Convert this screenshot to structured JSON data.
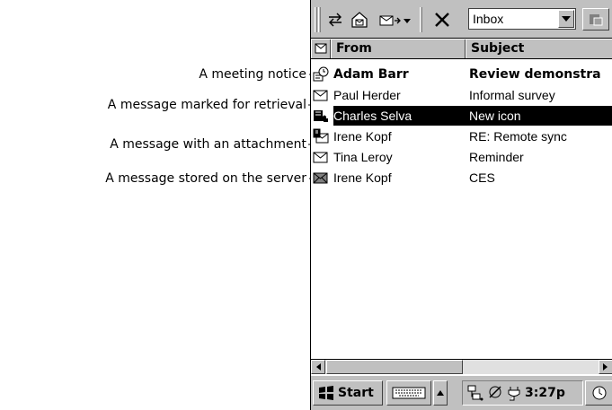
{
  "callouts": [
    {
      "text": "A meeting notice"
    },
    {
      "text": "A message marked for retrieval"
    },
    {
      "text": "A message with an attachment"
    },
    {
      "text": "A message stored on the server"
    }
  ],
  "toolbar": {
    "folder_selected": "Inbox",
    "icons": [
      "reply-arrows-icon",
      "send-receive-icon",
      "move-dropdown-icon",
      "delete-x-icon",
      "folder-dropdown-icon",
      "disabled-action-icon"
    ]
  },
  "list": {
    "columns": [
      "From",
      "Subject"
    ],
    "header_icon": "envelope-column-icon",
    "rows": [
      {
        "icon": "meeting-notice-icon",
        "from": "Adam Barr",
        "subject": "Review demonstra",
        "unread": true,
        "selected": false
      },
      {
        "icon": "envelope-icon",
        "from": "Paul Herder",
        "subject": "Informal survey",
        "unread": false,
        "selected": false
      },
      {
        "icon": "marked-for-retrieval-icon",
        "from": "Charles Selva",
        "subject": "New icon",
        "unread": false,
        "selected": true
      },
      {
        "icon": "attachment-icon",
        "from": "Irene Kopf",
        "subject": "RE: Remote sync",
        "unread": false,
        "selected": false
      },
      {
        "icon": "envelope-icon",
        "from": "Tina Leroy",
        "subject": "Reminder",
        "unread": false,
        "selected": false
      },
      {
        "icon": "server-message-icon",
        "from": "Irene Kopf",
        "subject": "CES",
        "unread": false,
        "selected": false
      }
    ]
  },
  "taskbar": {
    "start_label": "Start",
    "clock": "3:27p"
  },
  "colors": {
    "chrome": "#c0c0c0",
    "selection": "#000000",
    "background": "#ffffff"
  }
}
